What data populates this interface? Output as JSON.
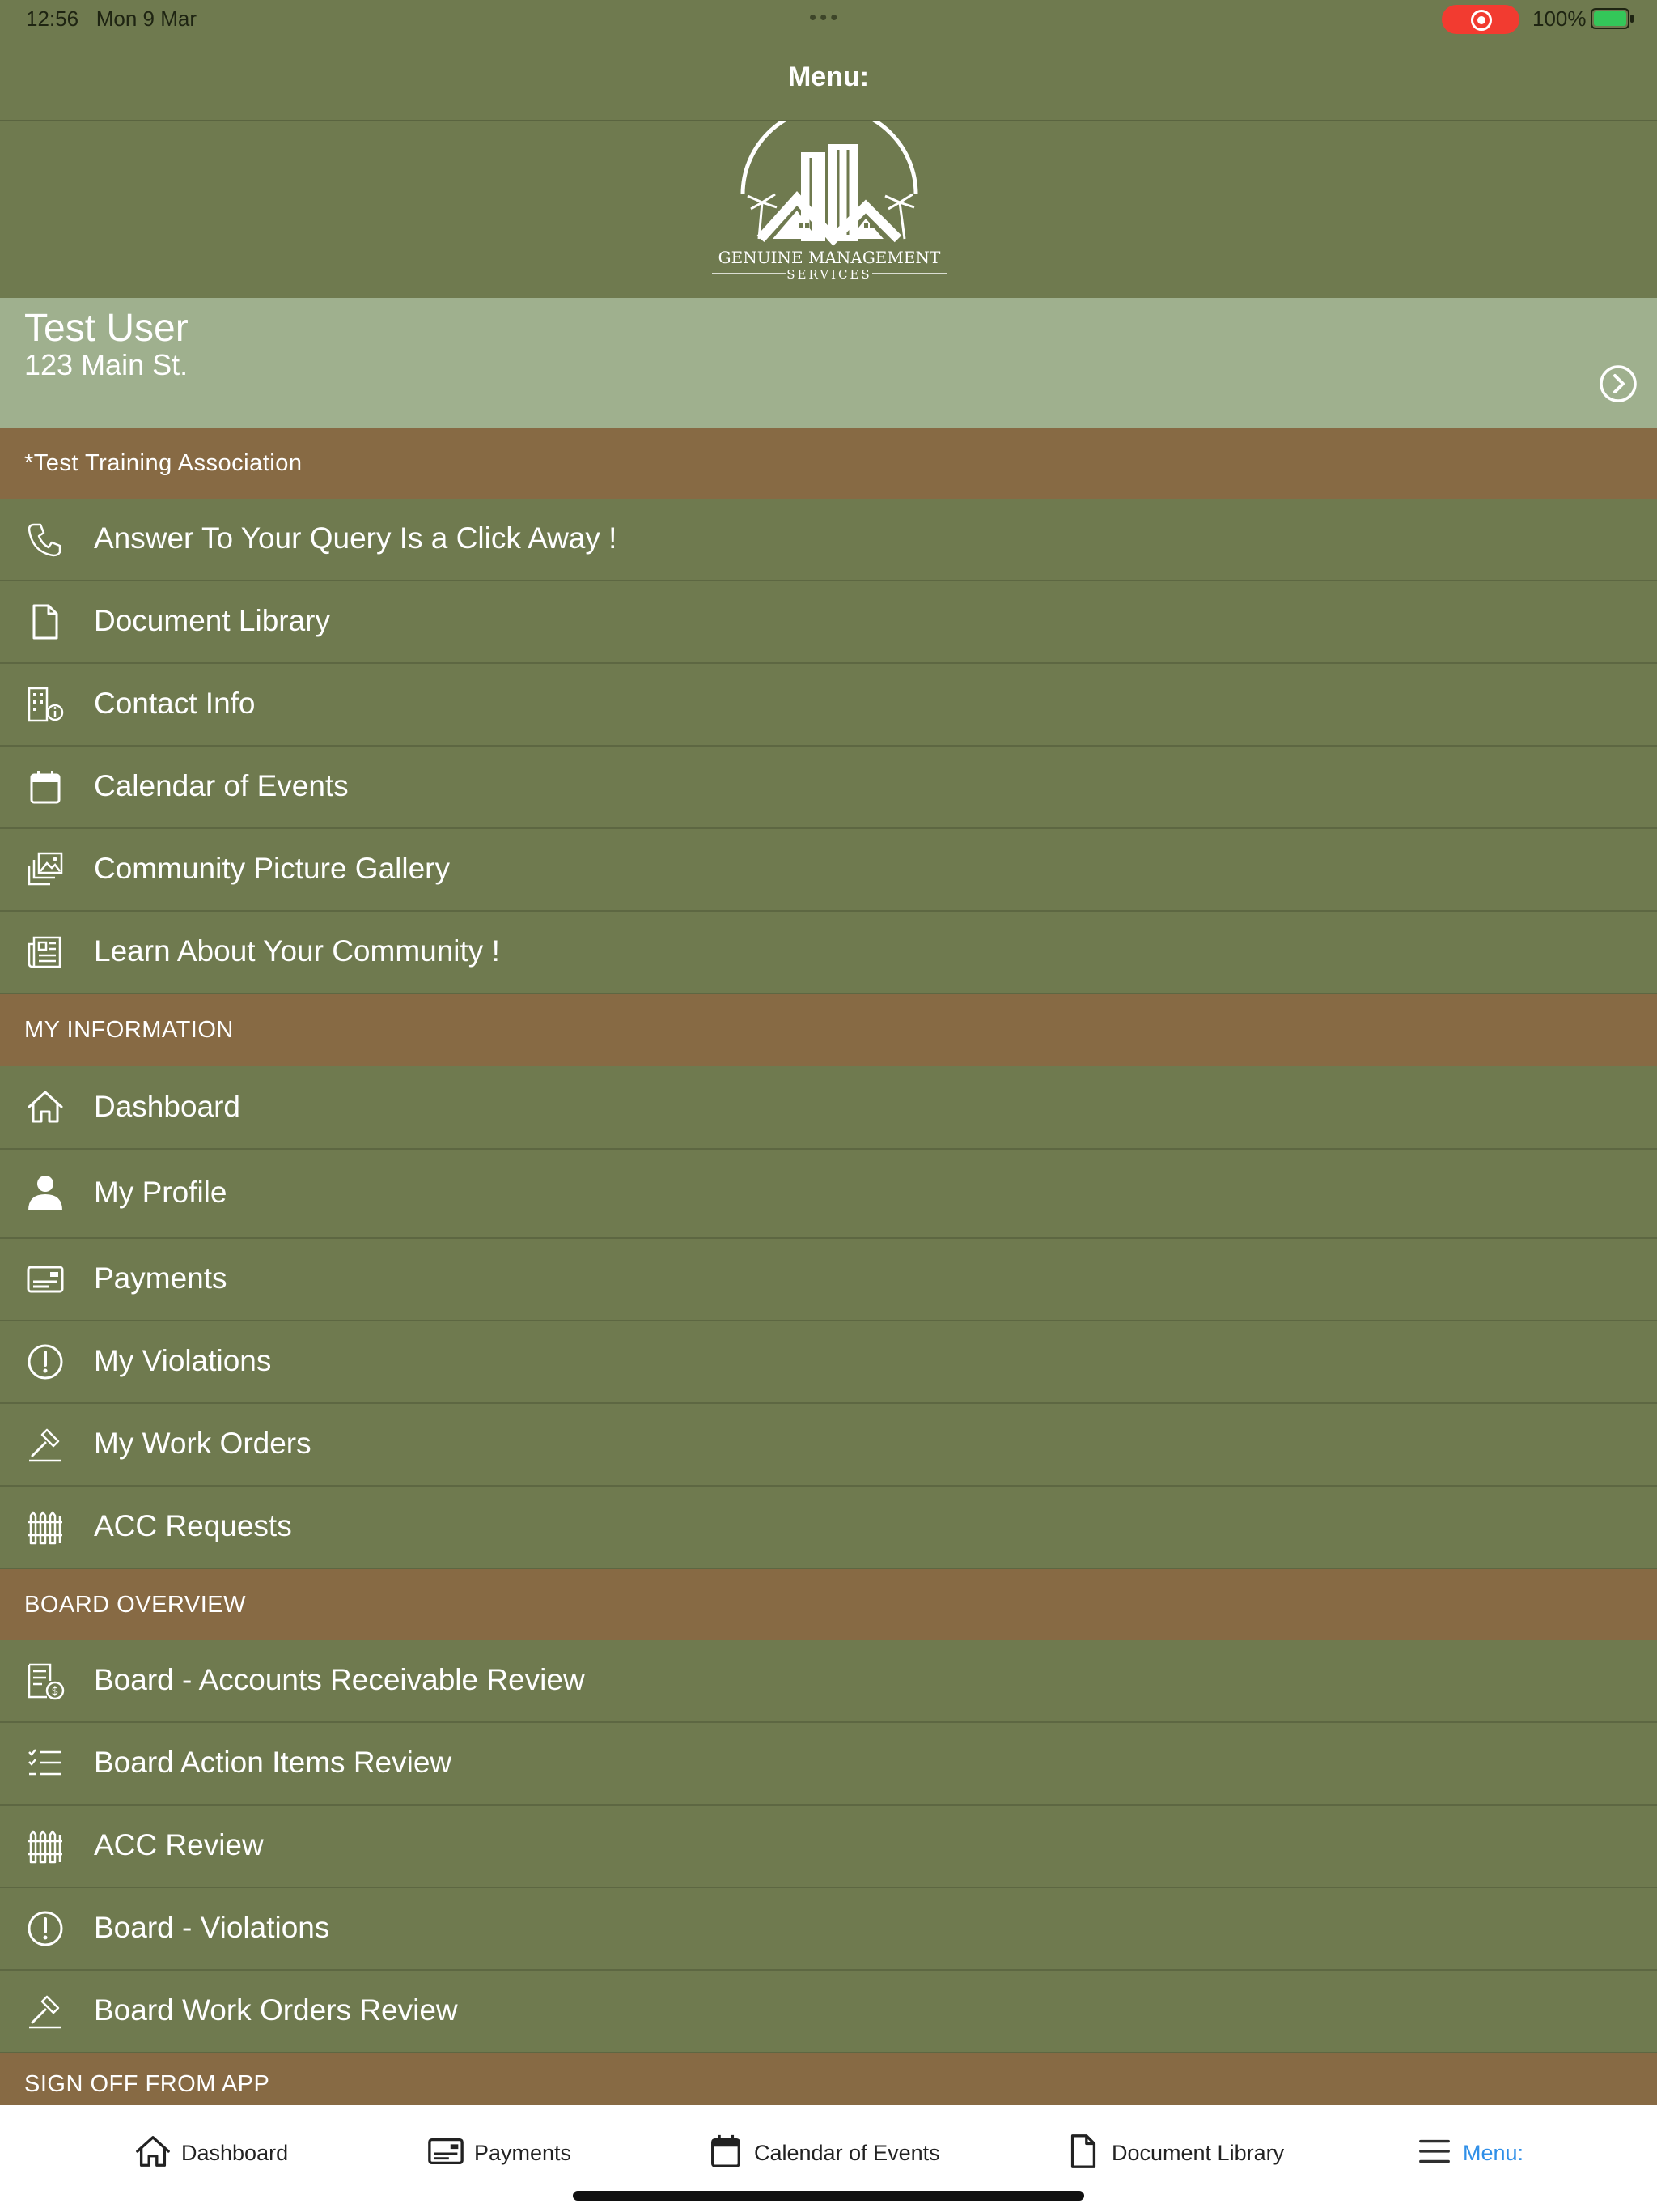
{
  "status": {
    "time": "12:56",
    "date": "Mon 9 Mar",
    "battery": "100%"
  },
  "nav": {
    "title": "Menu:"
  },
  "logo": {
    "line1": "GENUINE MANAGEMENT",
    "line2": "SERVICES"
  },
  "user": {
    "name": "Test User",
    "address": "123 Main St."
  },
  "sections": {
    "association": "*Test Training Association",
    "my_info": "MY INFORMATION",
    "board": "BOARD OVERVIEW",
    "signoff": "SIGN OFF FROM APP"
  },
  "association_items": [
    {
      "label": "Answer To Your Query Is a Click Away !",
      "icon": "phone-icon"
    },
    {
      "label": "Document Library",
      "icon": "document-icon"
    },
    {
      "label": "Contact Info",
      "icon": "building-info-icon"
    },
    {
      "label": "Calendar of Events",
      "icon": "calendar-icon"
    },
    {
      "label": "Community Picture Gallery",
      "icon": "gallery-icon"
    },
    {
      "label": "Learn About Your Community !",
      "icon": "newspaper-icon"
    }
  ],
  "my_info_items": [
    {
      "label": "Dashboard",
      "icon": "home-icon"
    },
    {
      "label": "My Profile",
      "icon": "person-icon"
    },
    {
      "label": "Payments",
      "icon": "payment-card-icon"
    },
    {
      "label": "My Violations",
      "icon": "alert-circle-icon"
    },
    {
      "label": "My Work Orders",
      "icon": "hammer-icon"
    },
    {
      "label": "ACC Requests",
      "icon": "fence-icon"
    }
  ],
  "board_items": [
    {
      "label": "Board - Accounts Receivable Review",
      "icon": "receivable-icon"
    },
    {
      "label": "Board Action Items Review",
      "icon": "checklist-icon"
    },
    {
      "label": "ACC Review",
      "icon": "fence-icon"
    },
    {
      "label": "Board - Violations",
      "icon": "alert-circle-icon"
    },
    {
      "label": "Board Work Orders Review",
      "icon": "hammer-icon"
    }
  ],
  "tabs": [
    {
      "label": "Dashboard",
      "icon": "home-icon"
    },
    {
      "label": "Payments",
      "icon": "payment-card-icon"
    },
    {
      "label": "Calendar of Events",
      "icon": "calendar-icon"
    },
    {
      "label": "Document Library",
      "icon": "document-icon"
    },
    {
      "label": "Menu:",
      "icon": "menu-icon",
      "active": true
    }
  ],
  "colors": {
    "background": "#6f7a4f",
    "user_bar": "#9fb08e",
    "section_header": "#876a44",
    "active_tab": "#2f8fe8"
  }
}
